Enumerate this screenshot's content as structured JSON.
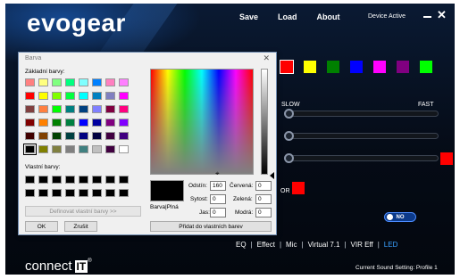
{
  "app": {
    "logo": "evogear",
    "nav": [
      "Save",
      "Load",
      "About"
    ],
    "device_status": "Device Active",
    "close_glyph": "✕",
    "swatches": [
      "#ff0000",
      "#ffff00",
      "#008000",
      "#0000ff",
      "#ff00ff",
      "#800080",
      "#00ff00"
    ],
    "selected_swatch": 0,
    "slider_labels": {
      "slow": "SLOW",
      "fast": "FAST"
    },
    "slider_swatch_color": "#ff0000",
    "or_label": "OR",
    "or_swatch_color": "#ff0000",
    "toggle_label": "NO",
    "bottom_nav": [
      "EQ",
      "Effect",
      "Mic",
      "Virtual 7.1",
      "VIR Eff",
      "LED"
    ],
    "active_bottom_item": "LED",
    "brand": {
      "text": "connect",
      "box": "IT",
      "reg": "®"
    },
    "profile": "Current Sound Setting: Profile 1"
  },
  "dialog": {
    "title": "Barva",
    "close_glyph": "✕",
    "basic_label": "Základní barvy:",
    "basic_colors": [
      [
        "#ff8080",
        "#ffff80",
        "#80ff80",
        "#00ff80",
        "#80ffff",
        "#0080ff",
        "#ff80c0",
        "#ff80ff"
      ],
      [
        "#ff0000",
        "#ffff00",
        "#80ff00",
        "#00ff40",
        "#00ffff",
        "#0080c0",
        "#8080c0",
        "#ff00ff"
      ],
      [
        "#804040",
        "#ff8040",
        "#00ff00",
        "#008080",
        "#004080",
        "#8080ff",
        "#800040",
        "#ff0080"
      ],
      [
        "#800000",
        "#ff8000",
        "#008000",
        "#008040",
        "#0000ff",
        "#0000a0",
        "#800080",
        "#8000ff"
      ],
      [
        "#400000",
        "#804000",
        "#004000",
        "#004040",
        "#000080",
        "#000040",
        "#400040",
        "#400080"
      ],
      [
        "#000000",
        "#808000",
        "#808040",
        "#808080",
        "#408080",
        "#c0c0c0",
        "#400040",
        "#ffffff"
      ]
    ],
    "selected_basic": [
      5,
      0
    ],
    "custom_label": "Vlastní barvy:",
    "custom_colors": [
      "#000000",
      "#000000",
      "#000000",
      "#000000",
      "#000000",
      "#000000",
      "#000000",
      "#000000",
      "#000000",
      "#000000",
      "#000000",
      "#000000",
      "#000000",
      "#000000",
      "#000000",
      "#000000"
    ],
    "define_button": "Definovat vlastní barvy >>",
    "ok_button": "OK",
    "cancel_button": "Zrušit",
    "preview_label": "Barva|Plná",
    "fields": {
      "hue_label": "Odstín:",
      "hue": "160",
      "sat_label": "Sytost:",
      "sat": "0",
      "lum_label": "Jas:",
      "lum": "0",
      "red_label": "Červená:",
      "red": "0",
      "green_label": "Zelená:",
      "green": "0",
      "blue_label": "Modrá:",
      "blue": "0"
    },
    "add_button": "Přidat do vlastních barev"
  }
}
